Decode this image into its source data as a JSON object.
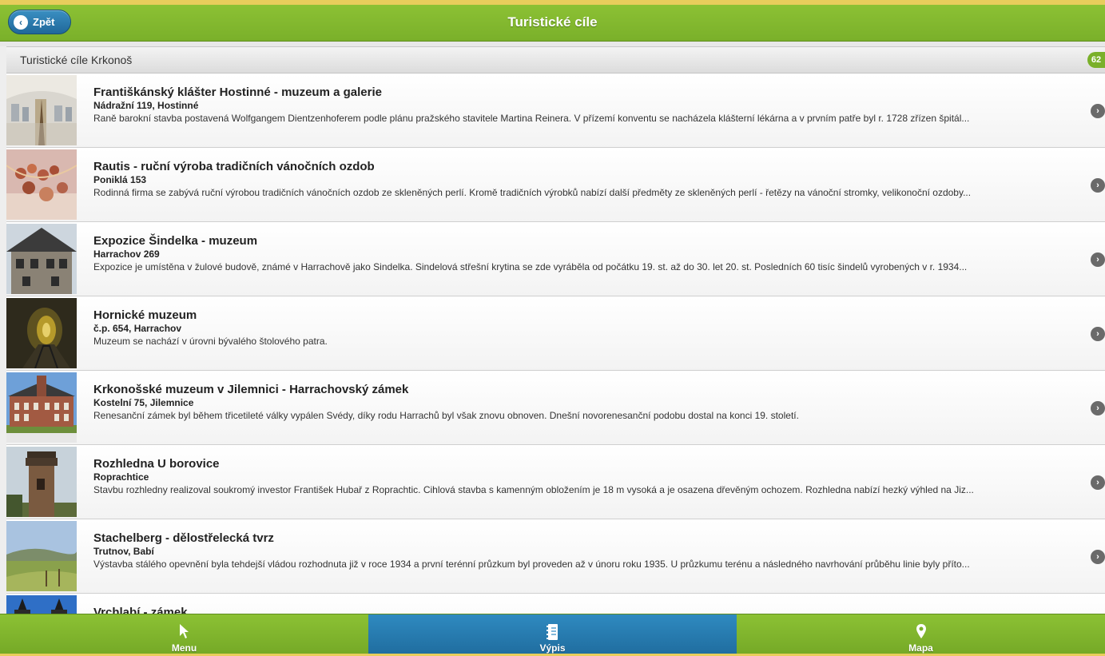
{
  "header": {
    "back_label": "Zpět",
    "title": "Turistické cíle"
  },
  "list": {
    "divider_label": "Turistické cíle Krkonoš",
    "count": "62",
    "items": [
      {
        "title": "Františkánský klášter Hostinné - muzeum a galerie",
        "address": "Nádražní 119, Hostinné",
        "description": "Raně barokní stavba postavená Wolfgangem Dientzenhoferem podle plánu pražského stavitele Martina Reinera. V přízemí konventu se nacházela klášterní lékárna a v prvním patře byl r. 1728 zřízen špitál..."
      },
      {
        "title": "Rautis - ruční výroba tradičních vánočních ozdob",
        "address": "Poniklá 153",
        "description": "Rodinná firma se zabývá ruční výrobou tradičních vánočních ozdob ze skleněných perlí. Kromě tradičních výrobků nabízí další předměty ze skleněných perlí - řetězy na vánoční stromky, velikonoční ozdoby..."
      },
      {
        "title": "Expozice Šindelka - muzeum",
        "address": "Harrachov 269",
        "description": "Expozice je umístěna v žulové budově, známé v Harrachově jako Sindelka. Sindelová střešní krytina se zde vyráběla od počátku 19. st. až do 30. let 20. st. Posledních 60 tisíc šindelů vyrobených v r. 1934..."
      },
      {
        "title": "Hornické muzeum",
        "address": "č.p. 654, Harrachov",
        "description": "Muzeum se nachází v úrovni bývalého štolového patra."
      },
      {
        "title": "Krkonošské muzeum v Jilemnici - Harrachovský zámek",
        "address": "Kostelní 75, Jilemnice",
        "description": "Renesanční zámek byl během třicetileté války vypálen Svédy, díky rodu Harrachů byl však znovu obnoven. Dnešní novorenesanční podobu dostal na konci 19. století."
      },
      {
        "title": "Rozhledna U borovice",
        "address": "Roprachtice",
        "description": "Stavbu rozhledny realizoval soukromý investor František Hubař z Roprachtic. Cihlová stavba s kamenným obložením je 18 m vysoká a je osazena dřevěným ochozem. Rozhledna nabízí hezký výhled na Jiz..."
      },
      {
        "title": "Stachelberg - dělostřelecká tvrz",
        "address": "Trutnov, Babí",
        "description": "Výstavba stálého opevnění byla tehdejší vládou rozhodnuta již v roce 1934 a první terénní průzkum byl proveden až v únoru roku 1935. U průzkumu terénu a následného navrhování průběhu linie byly příto..."
      },
      {
        "title": "Vrchlabí - zámek",
        "address": "",
        "description": ""
      }
    ]
  },
  "footer": {
    "tabs": [
      {
        "label": "Menu",
        "icon": "cursor-icon"
      },
      {
        "label": "Výpis",
        "icon": "list-icon"
      },
      {
        "label": "Mapa",
        "icon": "map-pin-icon"
      }
    ]
  },
  "colors": {
    "header_green": "#8cc134",
    "active_blue": "#2f8ac0",
    "frame_yellow": "#e8cd5c"
  }
}
